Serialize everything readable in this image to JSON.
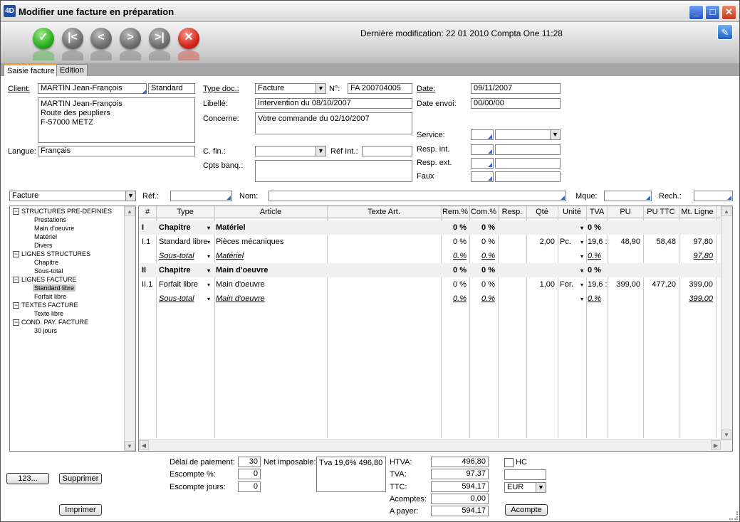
{
  "window": {
    "title": "Modifier une facture en préparation",
    "logo": "4D"
  },
  "toolbar": {
    "last_modified": "Dernière modification: 22 01 2010 Compta One 11:28"
  },
  "tabs": [
    {
      "label": "Saisie facture"
    },
    {
      "label": "Edition"
    }
  ],
  "client": {
    "client_label": "Client:",
    "client_value": "MARTIN Jean-François",
    "client_type": "Standard",
    "address": "MARTIN Jean-François\nRoute des peupliers\nF-57000 METZ",
    "langue_label": "Langue:",
    "langue_value": "Français"
  },
  "doc": {
    "type_label": "Type doc.:",
    "type_value": "Facture",
    "num_label": "N°:",
    "num_value": "FA 200704005",
    "libelle_label": "Libellé:",
    "libelle_value": "Intervention du 08/10/2007",
    "concerne_label": "Concerne:",
    "concerne_value": "Votre commande du 02/10/2007",
    "cfin_label": "C. fin.:",
    "refint_label": "Réf Int.:",
    "cpts_label": "Cpts banq.:"
  },
  "dates": {
    "date_label": "Date:",
    "date_value": "09/11/2007",
    "envoi_label": "Date envoi:",
    "envoi_value": "00/00/00",
    "service_label": "Service:",
    "respint_label": "Resp. int.",
    "respext_label": "Resp. ext.",
    "faux_label": "Faux"
  },
  "filter": {
    "type_value": "Facture",
    "ref_label": "Réf.:",
    "nom_label": "Nom:",
    "mque_label": "Mque:",
    "rech_label": "Rech.:"
  },
  "tree": [
    {
      "label": "STRUCTURES PRE-DEFINIES",
      "children": [
        "Prestations",
        "Main d'oeuvre",
        "Matériel",
        "Divers"
      ]
    },
    {
      "label": "LIGNES STRUCTURES",
      "children": [
        "Chapitre",
        "Sous-total"
      ]
    },
    {
      "label": "LIGNES FACTURE",
      "children": [
        "Standard libre",
        "Forfait libre"
      ]
    },
    {
      "label": "TEXTES FACTURE",
      "children": [
        "Texte libre"
      ]
    },
    {
      "label": "COND. PAY. FACTURE",
      "children": [
        "30 jours"
      ]
    }
  ],
  "grid": {
    "columns": [
      "#",
      "Type",
      "Article",
      "Texte Art.",
      "Rem.%",
      "Com.%",
      "Resp.",
      "Qté",
      "Unité",
      "TVA",
      "PU",
      "PU TTC",
      "Mt. Ligne"
    ],
    "rows": [
      {
        "kind": "chap",
        "num": "I",
        "type": "Chapitre",
        "article": "Matériel",
        "rem": "0 %",
        "com": "0 %",
        "qte": "",
        "unite": "",
        "tva": "0 %",
        "pu": "",
        "puttc": "",
        "mt": ""
      },
      {
        "kind": "line",
        "num": "I.1",
        "type": "Standard libre",
        "article": "Pièces mécaniques",
        "rem": "0 %",
        "com": "0 %",
        "qte": "2,00",
        "unite": "Pc.",
        "tva": "19,6 :",
        "pu": "48,90",
        "puttc": "58,48",
        "mt": "97,80"
      },
      {
        "kind": "sub",
        "num": "",
        "type": "Sous-total",
        "article": "Matériel",
        "rem": "0.%",
        "com": "0.%",
        "qte": "",
        "unite": "",
        "tva": "0.%",
        "pu": "",
        "puttc": "",
        "mt": "97,80"
      },
      {
        "kind": "chap",
        "num": "II",
        "type": "Chapitre",
        "article": "Main d'oeuvre",
        "rem": "0 %",
        "com": "0 %",
        "qte": "",
        "unite": "",
        "tva": "0 %",
        "pu": "",
        "puttc": "",
        "mt": ""
      },
      {
        "kind": "line",
        "num": "II.1",
        "type": "Forfait libre",
        "article": "Main d'oeuvre",
        "rem": "0 %",
        "com": "0 %",
        "qte": "1,00",
        "unite": "For.",
        "tva": "19,6 :",
        "pu": "399,00",
        "puttc": "477,20",
        "mt": "399,00"
      },
      {
        "kind": "sub",
        "num": "",
        "type": "Sous-total",
        "article": "Main d'oeuvre",
        "rem": "0.%",
        "com": "0.%",
        "qte": "",
        "unite": "",
        "tva": "0.%",
        "pu": "",
        "puttc": "",
        "mt": "399,00"
      }
    ]
  },
  "footer": {
    "btn_123": "123...",
    "btn_supprimer": "Supprimer",
    "btn_imprimer": "Imprimer",
    "delai_label": "Délai de paiement:",
    "delai_value": "30",
    "escompte_label": "Escompte %:",
    "escompte_value": "0",
    "escjours_label": "Escompte jours:",
    "escjours_value": "0",
    "net_label": "Net imposable:",
    "net_value": "Tva 19,6% 496,80",
    "htva_label": "HTVA:",
    "htva_value": "496,80",
    "tva_label": "TVA:",
    "tva_value": "97,37",
    "ttc_label": "TTC:",
    "ttc_value": "594,17",
    "acomptes_label": "Acomptes:",
    "acomptes_value": "0,00",
    "apayer_label": "A payer:",
    "apayer_value": "594,17",
    "hc_label": "HC",
    "currency": "EUR",
    "btn_acompte": "Acompte"
  },
  "colors": {
    "accent_tab": "#f3a33b",
    "ok": "#2bae1d",
    "cancel": "#d4271b",
    "field_marker": "#3866c8"
  }
}
